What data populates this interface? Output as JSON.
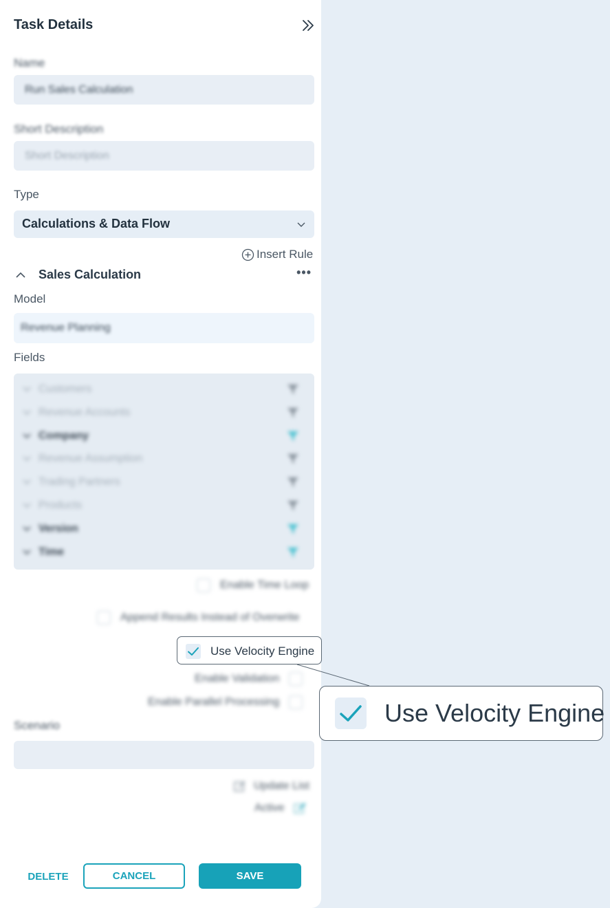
{
  "panel": {
    "title": "Task Details",
    "name_label": "Name",
    "name_value": "Run Sales Calculation",
    "short_desc_label": "Short Description",
    "short_desc_placeholder": "Short Description",
    "type_label": "Type",
    "type_value": "Calculations & Data Flow",
    "insert_rule": "Insert Rule"
  },
  "section": {
    "title": "Sales Calculation",
    "more": "•••",
    "model_label": "Model",
    "model_value": "Revenue Planning",
    "fields_label": "Fields",
    "fields": [
      {
        "name": "Customers",
        "active": false
      },
      {
        "name": "Revenue Accounts",
        "active": false
      },
      {
        "name": "Company",
        "active": true
      },
      {
        "name": "Revenue Assumption",
        "active": false
      },
      {
        "name": "Trading Partners",
        "active": false
      },
      {
        "name": "Products",
        "active": false
      },
      {
        "name": "Version",
        "active": true
      },
      {
        "name": "Time",
        "active": true
      }
    ]
  },
  "options": {
    "enable_time_loop": "Enable Time Loop",
    "append_results": "Append Results Instead of Overwrite",
    "use_velocity_engine": "Use Velocity Engine",
    "use_velocity_engine_checked": true,
    "enable_validation": "Enable Validation",
    "enable_parallel": "Enable Parallel Processing"
  },
  "scenario": {
    "label": "Scenario",
    "update_list": "Update List",
    "active": "Active"
  },
  "buttons": {
    "delete": "DELETE",
    "cancel": "CANCEL",
    "save": "SAVE"
  },
  "colors": {
    "accent": "#17a2b8",
    "panel_bg": "#ffffff",
    "page_bg": "#e6eef6",
    "field_bg": "#e8eef5"
  }
}
